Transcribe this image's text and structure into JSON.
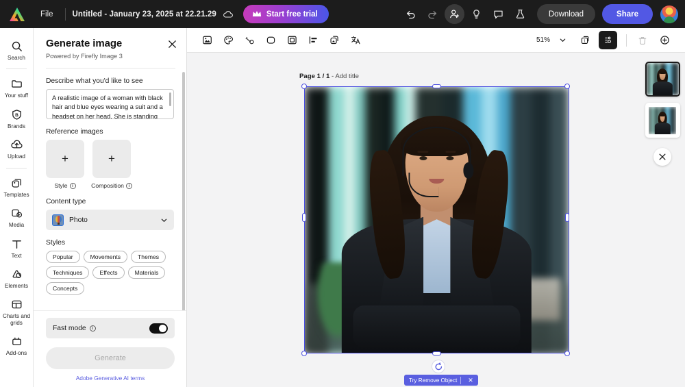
{
  "topbar": {
    "logo": "adobe-express-logo",
    "file_menu": "File",
    "doc_title": "Untitled - January 23, 2025 at 22.21.29",
    "cloud_icon": "cloud-saved-icon",
    "trial_label": "Start free trial",
    "trial_icon": "crown-icon",
    "icons": [
      {
        "name": "undo-icon",
        "title": "Undo"
      },
      {
        "name": "redo-icon",
        "title": "Redo"
      },
      {
        "name": "add-person-icon",
        "title": "Invite"
      },
      {
        "name": "lightbulb-icon",
        "title": "Ideas"
      },
      {
        "name": "comment-icon",
        "title": "Comments"
      },
      {
        "name": "flask-icon",
        "title": "Experiments"
      }
    ],
    "download_label": "Download",
    "share_label": "Share",
    "avatar": "user-avatar",
    "colors": {
      "bar_bg": "#1c1c1c",
      "share_bg": "#5258e4"
    }
  },
  "rail": {
    "items": [
      {
        "label": "Search",
        "icon": "search-icon"
      },
      {
        "label": "Your stuff",
        "icon": "folder-icon"
      },
      {
        "label": "Brands",
        "icon": "brand-shield-icon"
      },
      {
        "label": "Upload",
        "icon": "upload-cloud-icon"
      },
      {
        "label": "Templates",
        "icon": "templates-icon"
      },
      {
        "label": "Media",
        "icon": "media-icon"
      },
      {
        "label": "Text",
        "icon": "text-icon"
      },
      {
        "label": "Elements",
        "icon": "elements-icon"
      },
      {
        "label": "Charts and grids",
        "icon": "charts-grids-icon"
      },
      {
        "label": "Add-ons",
        "icon": "add-ons-icon"
      }
    ]
  },
  "panel": {
    "title": "Generate image",
    "subtitle": "Powered by Firefly Image 3",
    "close_icon": "close-icon",
    "prompt_label": "Describe what you'd like to see",
    "prompt_value": "A realistic image of a woman with black hair and blue eyes wearing a suit and a headset on her head. She is standing in",
    "reference_label": "Reference images",
    "reference_tiles": [
      {
        "caption": "Style",
        "plus": "+",
        "info_icon": "info-icon"
      },
      {
        "caption": "Composition",
        "plus": "+",
        "info_icon": "info-icon"
      }
    ],
    "content_type_label": "Content type",
    "content_type_value": "Photo",
    "content_type_icon": "photo-balloon-icon",
    "chevron_icon": "chevron-down-icon",
    "styles_label": "Styles",
    "style_chips": [
      "Popular",
      "Movements",
      "Themes",
      "Techniques",
      "Effects",
      "Materials",
      "Concepts"
    ],
    "fast_mode_label": "Fast mode",
    "fast_mode_info_icon": "info-icon",
    "fast_mode_on": true,
    "generate_label": "Generate",
    "generate_disabled": true,
    "terms_label": "Adobe Generative AI terms",
    "terms_color": "#5b5ee0"
  },
  "canvas_toolbar": {
    "left_icons": [
      {
        "name": "generative-fill-icon"
      },
      {
        "name": "color-palette-icon"
      },
      {
        "name": "magic-wand-icon"
      },
      {
        "name": "crop-shape-icon"
      },
      {
        "name": "frame-icon"
      },
      {
        "name": "align-icon"
      },
      {
        "name": "duplicate-icon"
      },
      {
        "name": "translate-icon"
      }
    ],
    "zoom_value": "51%",
    "zoom_chevron": "chevron-down-icon",
    "page_count_icon": "page-count-icon",
    "page_count_value": "1",
    "layers_icon": "layers-panel-icon",
    "layers_active": true,
    "delete_icon": "trash-icon",
    "add_page_icon": "add-page-icon"
  },
  "canvas": {
    "page_label_prefix": "Page",
    "page_current": "1",
    "page_separator": "/",
    "page_total": "1",
    "add_title_label": "- Add title",
    "selection_color": "#4a4ee0",
    "rotate_icon": "rotate-handle-icon",
    "remove_badge_label": "Try Remove Object",
    "remove_badge_close": "✕",
    "remove_badge_color": "#5a5fe0",
    "image_alt": "woman-with-headset-photo"
  },
  "pages_panel": {
    "thumbnails": [
      {
        "name": "page-thumbnail-1",
        "selected": true
      },
      {
        "name": "page-thumbnail-2",
        "selected": false
      }
    ],
    "close_icon": "close-icon",
    "close_label": "✕"
  }
}
